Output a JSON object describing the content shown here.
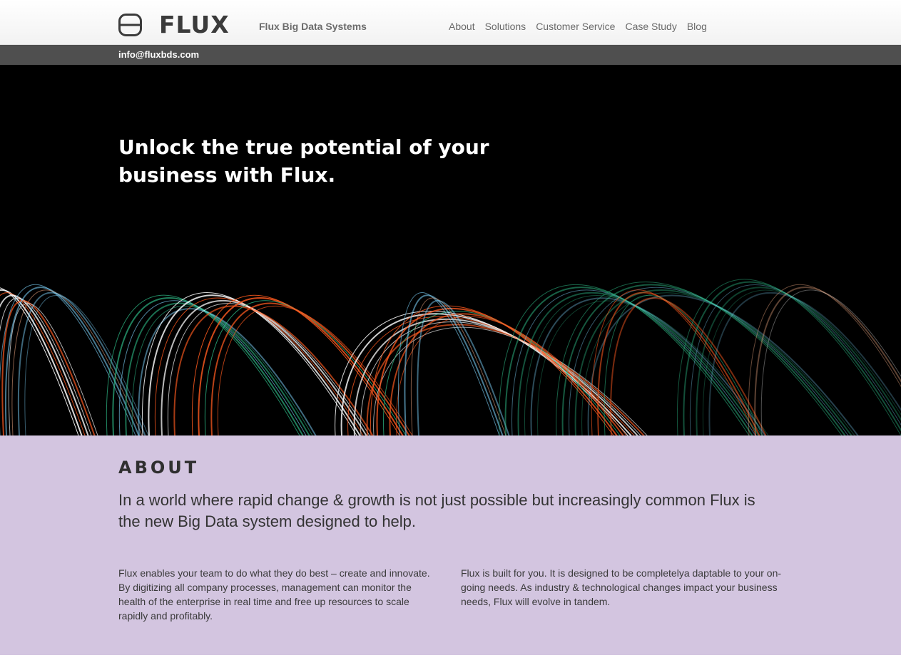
{
  "header": {
    "logo_text": "FLUX",
    "tagline": "Flux Big Data Systems",
    "nav": [
      "About",
      "Solutions",
      "Customer Service",
      "Case Study",
      "Blog"
    ]
  },
  "infobar": {
    "email": "info@fluxbds.com"
  },
  "hero": {
    "headline": "Unlock the true potential of your business with Flux."
  },
  "about": {
    "title": "ABOUT",
    "lead": "In a world where rapid change & growth is not just possible but increasingly common Flux is the new Big Data system designed to help.",
    "col1": "Flux enables your team to do what they do best – create and innovate. By digitizing all company processes, management can monitor the health of the enterprise in real time and free up resources to scale rapidly and profitably.",
    "col2": "Flux is built for you. It is designed to be completelya daptable to your on-going needs. As industry & technological changes impact your business needs, Flux will evolve in tandem."
  },
  "colors": {
    "header_bg": "#f7f7f7",
    "infobar_bg": "#4f4f4f",
    "hero_bg": "#000000",
    "about_bg": "#d3c5e0",
    "streak_colors": [
      "#ffffff",
      "#ff5a1f",
      "#2fbf8a",
      "#7fd6ff",
      "#ffb38a"
    ]
  },
  "icons": {
    "logo": "flux-logo-icon"
  }
}
